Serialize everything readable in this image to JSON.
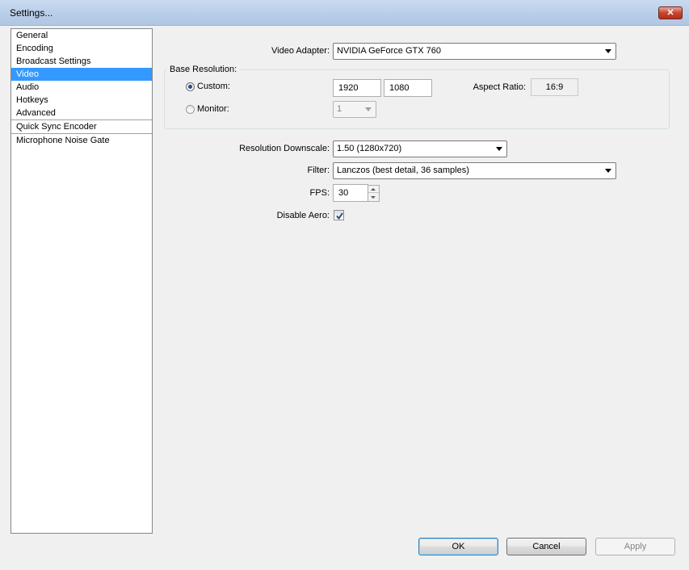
{
  "window": {
    "title": "Settings...",
    "close_label": "✕"
  },
  "sidebar": {
    "items": [
      {
        "label": "General"
      },
      {
        "label": "Encoding"
      },
      {
        "label": "Broadcast Settings"
      },
      {
        "label": "Video"
      },
      {
        "label": "Audio"
      },
      {
        "label": "Hotkeys"
      },
      {
        "label": "Advanced"
      },
      {
        "label": "Quick Sync Encoder"
      },
      {
        "label": "Microphone Noise Gate"
      }
    ],
    "selected_index": 3
  },
  "video": {
    "adapter_label": "Video Adapter:",
    "adapter_value": "NVIDIA GeForce GTX 760",
    "base_resolution": {
      "title": "Base Resolution:",
      "custom_label": "Custom:",
      "custom_checked": true,
      "width": "1920",
      "height": "1080",
      "aspect_label": "Aspect Ratio:",
      "aspect_value": "16:9",
      "monitor_label": "Monitor:",
      "monitor_checked": false,
      "monitor_value": "1"
    },
    "downscale_label": "Resolution Downscale:",
    "downscale_value": "1.50  (1280x720)",
    "filter_label": "Filter:",
    "filter_value": "Lanczos (best detail, 36 samples)",
    "fps_label": "FPS:",
    "fps_value": "30",
    "disable_aero_label": "Disable Aero:",
    "disable_aero_checked": true
  },
  "buttons": {
    "ok": "OK",
    "cancel": "Cancel",
    "apply": "Apply"
  }
}
